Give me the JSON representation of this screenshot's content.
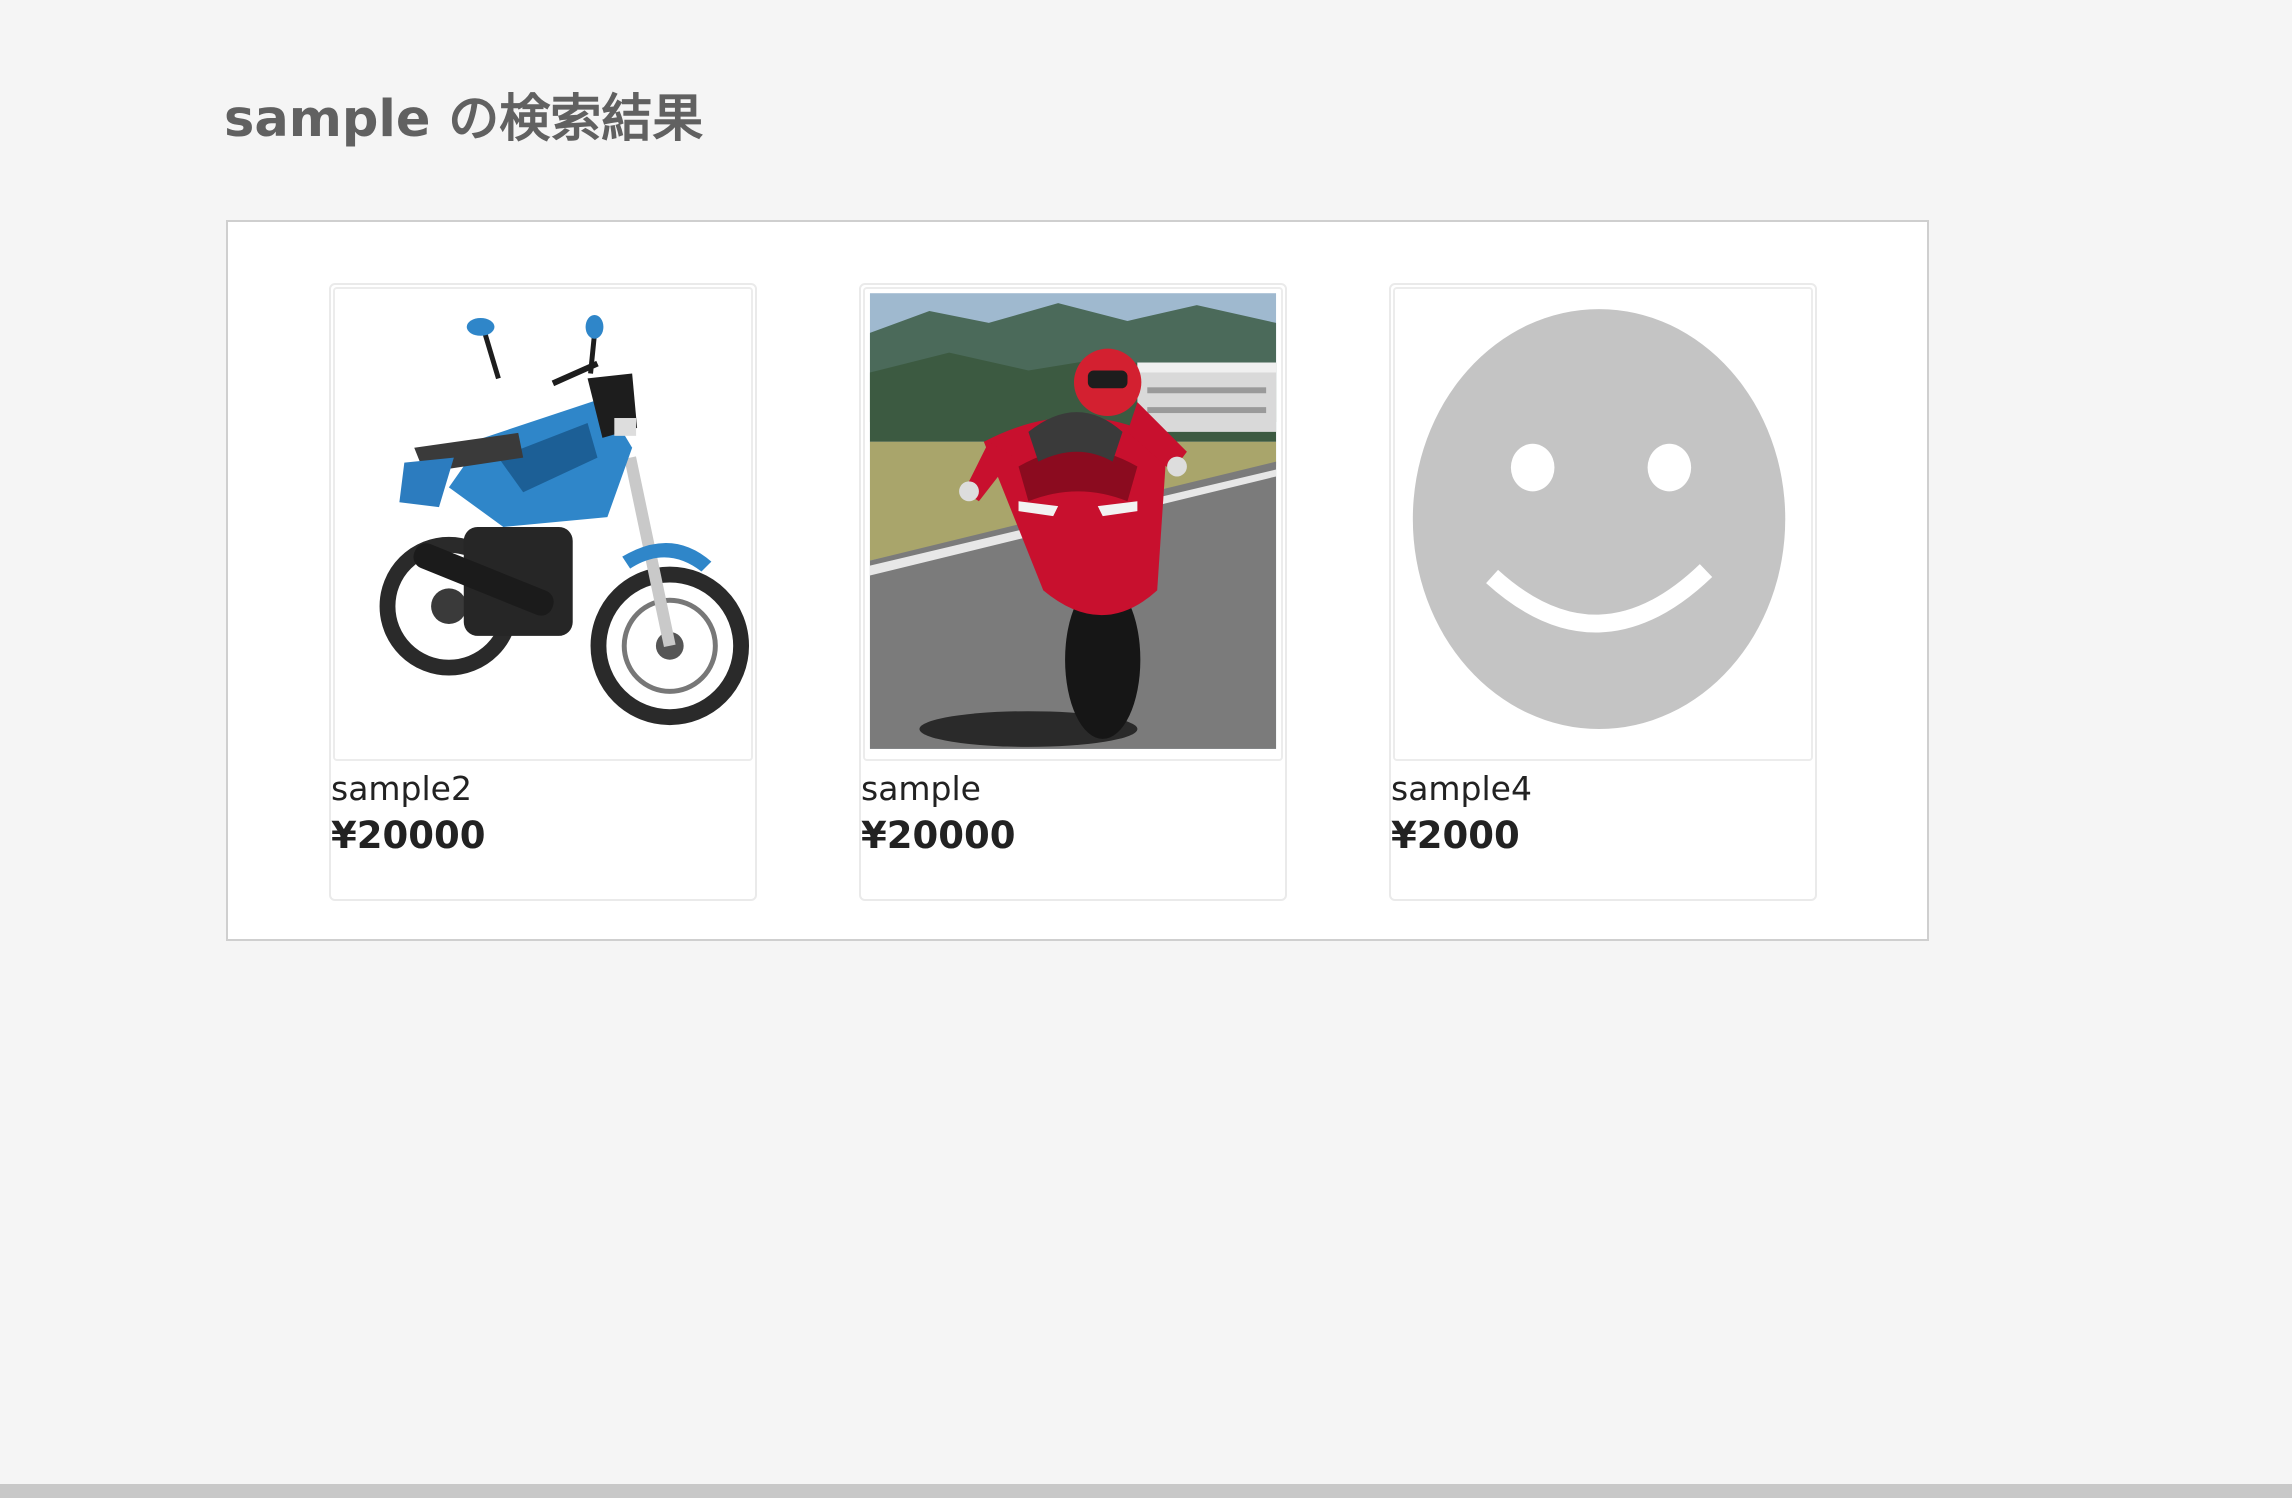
{
  "search": {
    "title": "sample の検索結果"
  },
  "results": [
    {
      "name": "sample2",
      "price": "¥20000",
      "image_icon": "blue-motorcycle-photo"
    },
    {
      "name": "sample",
      "price": "¥20000",
      "image_icon": "red-racing-motorcycle-photo"
    },
    {
      "name": "sample4",
      "price": "¥2000",
      "image_icon": "smiley-face-placeholder-icon"
    }
  ],
  "colors": {
    "background": "#f5f5f5",
    "panel": "#ffffff",
    "title_text": "#616161",
    "body_text": "#222222",
    "placeholder_gray": "#c4c4c4"
  }
}
